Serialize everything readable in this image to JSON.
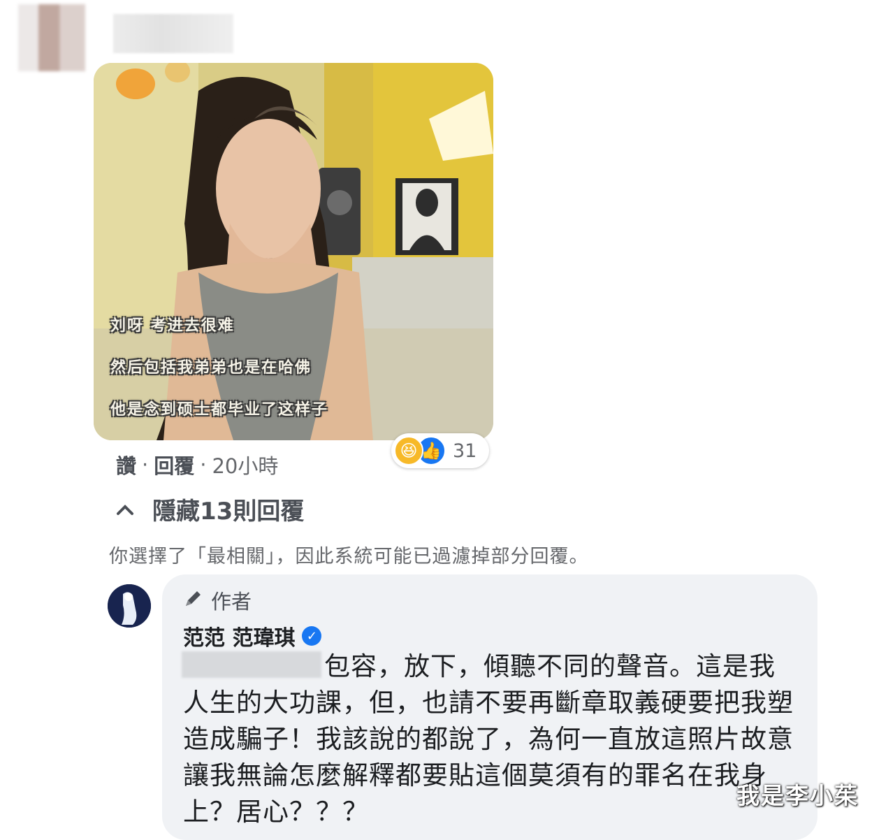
{
  "comment": {
    "image": {
      "subtitles": [
        "刘呀 考进去很难",
        "然后包括我弟弟也是在哈佛",
        "他是念到硕士都毕业了这样子"
      ]
    },
    "reactions": {
      "icons": [
        "haha-icon",
        "like-icon"
      ],
      "count": "31"
    },
    "actions": {
      "like": "讚",
      "reply": "回覆",
      "time": "20小時",
      "separator": "·"
    }
  },
  "replies": {
    "toggle_label": "隱藏13則回覆",
    "notice": "你選擇了「最相關」，因此系統可能已過濾掉部分回覆。"
  },
  "author_reply": {
    "badge": "作者",
    "name": "范范 范瑋琪",
    "text": "包容，放下，傾聽不同的聲音。這是我人生的大功課，但，也請不要再斷章取義硬要把我塑造成騙子！我該說的都說了，為何一直放這照片故意讓我無論怎麼解釋都要貼這個莫須有的罪名在我身上？居心？？？"
  },
  "watermark": "我是李小茱",
  "colors": {
    "bubble": "#f0f2f5",
    "verified": "#1877f2",
    "like": "#1877f2",
    "haha": "#f7b928"
  }
}
